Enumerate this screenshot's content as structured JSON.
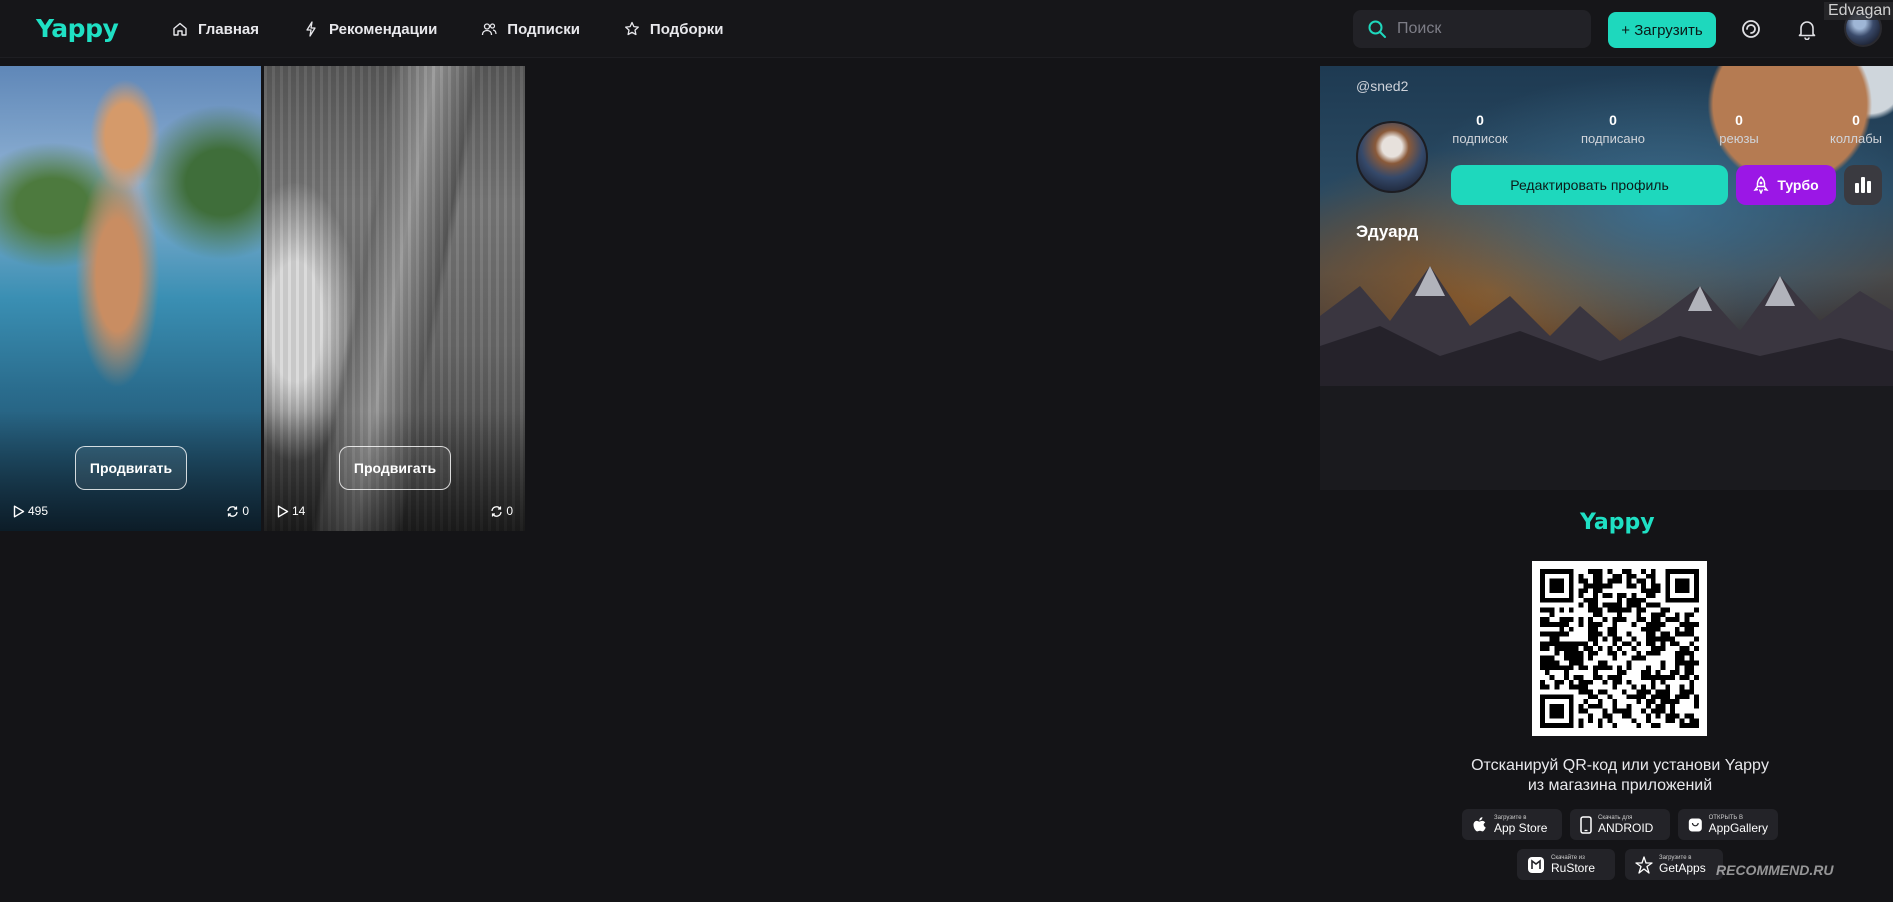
{
  "header": {
    "logo": "Yappy",
    "nav": [
      {
        "label": "Главная",
        "icon": "home-icon"
      },
      {
        "label": "Рекомендации",
        "icon": "spark-icon"
      },
      {
        "label": "Подписки",
        "icon": "people-icon"
      },
      {
        "label": "Подборки",
        "icon": "star-icon"
      }
    ],
    "search_placeholder": "Поиск",
    "upload_label": "+ Загрузить",
    "corner_user": "Edvagan"
  },
  "videos": [
    {
      "promote_label": "Продвигать",
      "views": "495",
      "reposts": "0"
    },
    {
      "promote_label": "Продвигать",
      "views": "14",
      "reposts": "0"
    }
  ],
  "profile": {
    "handle": "@sned2",
    "name": "Эдуард",
    "stats": [
      {
        "value": "0",
        "label": "подписок"
      },
      {
        "value": "0",
        "label": "подписано"
      },
      {
        "value": "0",
        "label": "реюзы"
      },
      {
        "value": "0",
        "label": "коллабы"
      }
    ],
    "edit_label": "Редактировать профиль",
    "turbo_label": "Турбо"
  },
  "download": {
    "logo": "Yappy",
    "line1": "Отсканируй QR-код или установи Yappy",
    "line2": "из магазина приложений",
    "stores": [
      {
        "small": "Загрузите в",
        "big": "App Store"
      },
      {
        "small": "Скачать для",
        "big": "ANDROID"
      },
      {
        "small": "ОТКРЫТЬ В",
        "big": "AppGallery"
      },
      {
        "small": "Скачайте из",
        "big": "RuStore"
      },
      {
        "small": "Загрузите в",
        "big": "GetApps"
      }
    ]
  },
  "watermark": "RECOMMEND.RU",
  "colors": {
    "accent": "#1ed8bd",
    "turbo": "#9b17e6",
    "background": "#141417"
  }
}
